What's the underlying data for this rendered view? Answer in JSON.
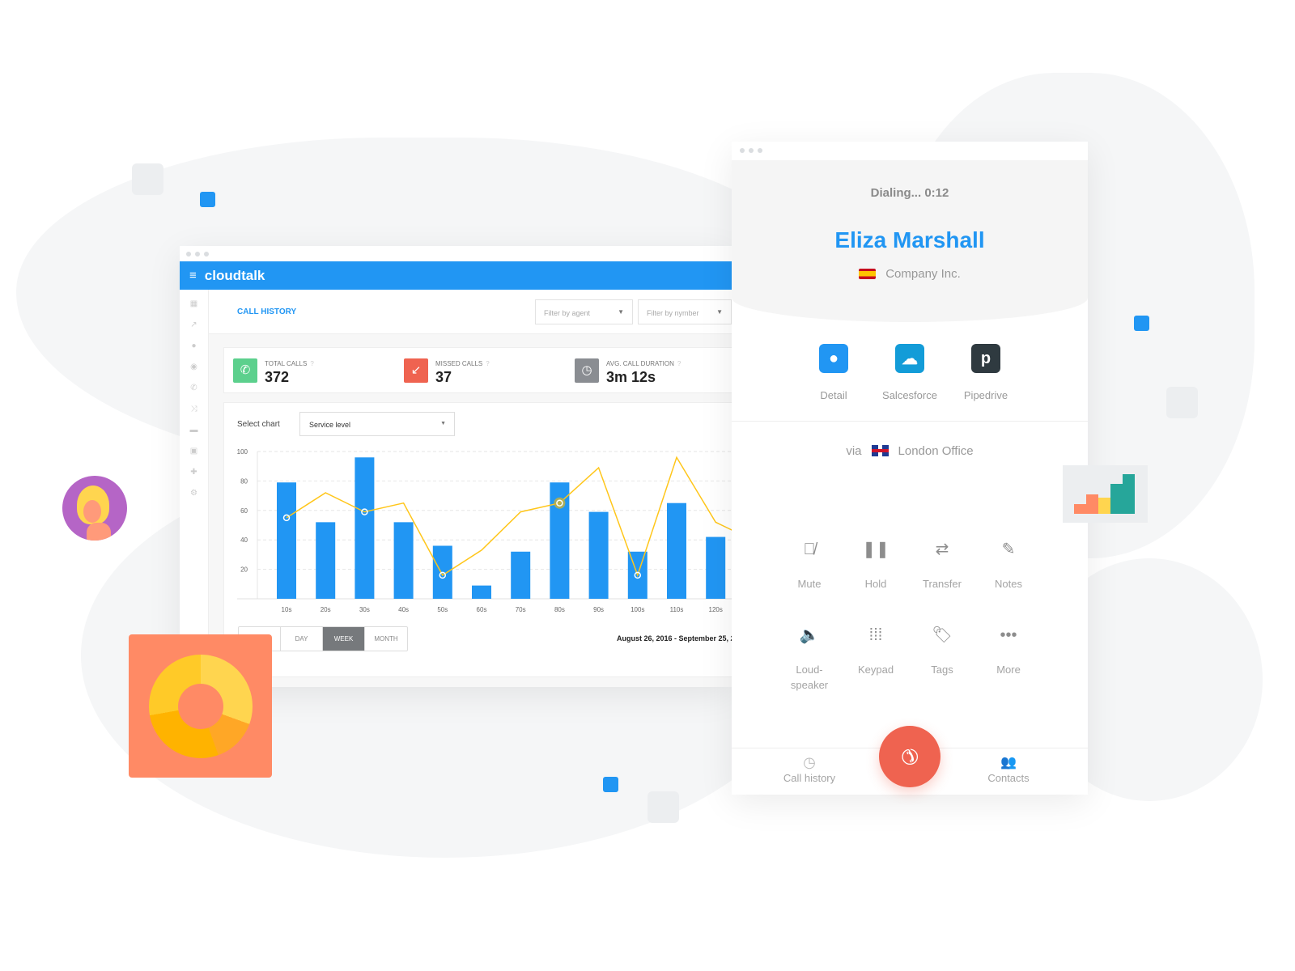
{
  "dashboard": {
    "brand": "cloudtalk",
    "page_title": "CALL HISTORY",
    "filters": [
      {
        "placeholder": "Filter by agent"
      },
      {
        "placeholder": "Filter by nymber"
      }
    ],
    "stats": [
      {
        "label": "TOTAL CALLS",
        "value": "372",
        "color": "#5cd08d",
        "icon": "phone-icon"
      },
      {
        "label": "MISSED CALLS",
        "value": "37",
        "color": "#ef6350",
        "icon": "missed-call-icon"
      },
      {
        "label": "AVG. CALL DURATION",
        "value": "3m 12s",
        "color": "#8a8d92",
        "icon": "clock-icon"
      }
    ],
    "select_chart_label": "Select chart",
    "select_chart_value": "Service level",
    "range_tabs": [
      "",
      "DAY",
      "WEEK",
      "MONTH"
    ],
    "active_range": "WEEK",
    "date_range": "August 26, 2016 - September 25, 20"
  },
  "chart_data": {
    "type": "bar",
    "categories": [
      "10s",
      "20s",
      "30s",
      "40s",
      "50s",
      "60s",
      "70s",
      "80s",
      "90s",
      "100s",
      "110s",
      "120s"
    ],
    "series": [
      {
        "type": "bar",
        "color": "#2196f3",
        "values": [
          79,
          52,
          96,
          52,
          36,
          9,
          32,
          79,
          59,
          32,
          65,
          42
        ]
      },
      {
        "type": "line",
        "color": "#ffc61a",
        "values": [
          55,
          72,
          59,
          65,
          16,
          33,
          59,
          65,
          89,
          16,
          96,
          52
        ]
      }
    ],
    "yticks": [
      20,
      40,
      60,
      80,
      100
    ],
    "ylim": [
      0,
      100
    ],
    "grid": true
  },
  "phone": {
    "status": "Dialing... 0:12",
    "contact_name": "Eliza Marshall",
    "company": "Company Inc.",
    "integrations": [
      {
        "label": "Detail",
        "color": "#2196f3"
      },
      {
        "label": "Salcesforce",
        "color": "#139cd8"
      },
      {
        "label": "Pipedrive",
        "color": "#2f3a40"
      }
    ],
    "via_label": "via",
    "via_line": "London Office",
    "actions": [
      "Mute",
      "Hold",
      "Transfer",
      "Notes",
      "Loud-\nspeaker",
      "Keypad",
      "Tags",
      "More"
    ],
    "nav": {
      "left": "Call history",
      "right": "Contacts"
    },
    "hangup_color": "#ef6350"
  }
}
